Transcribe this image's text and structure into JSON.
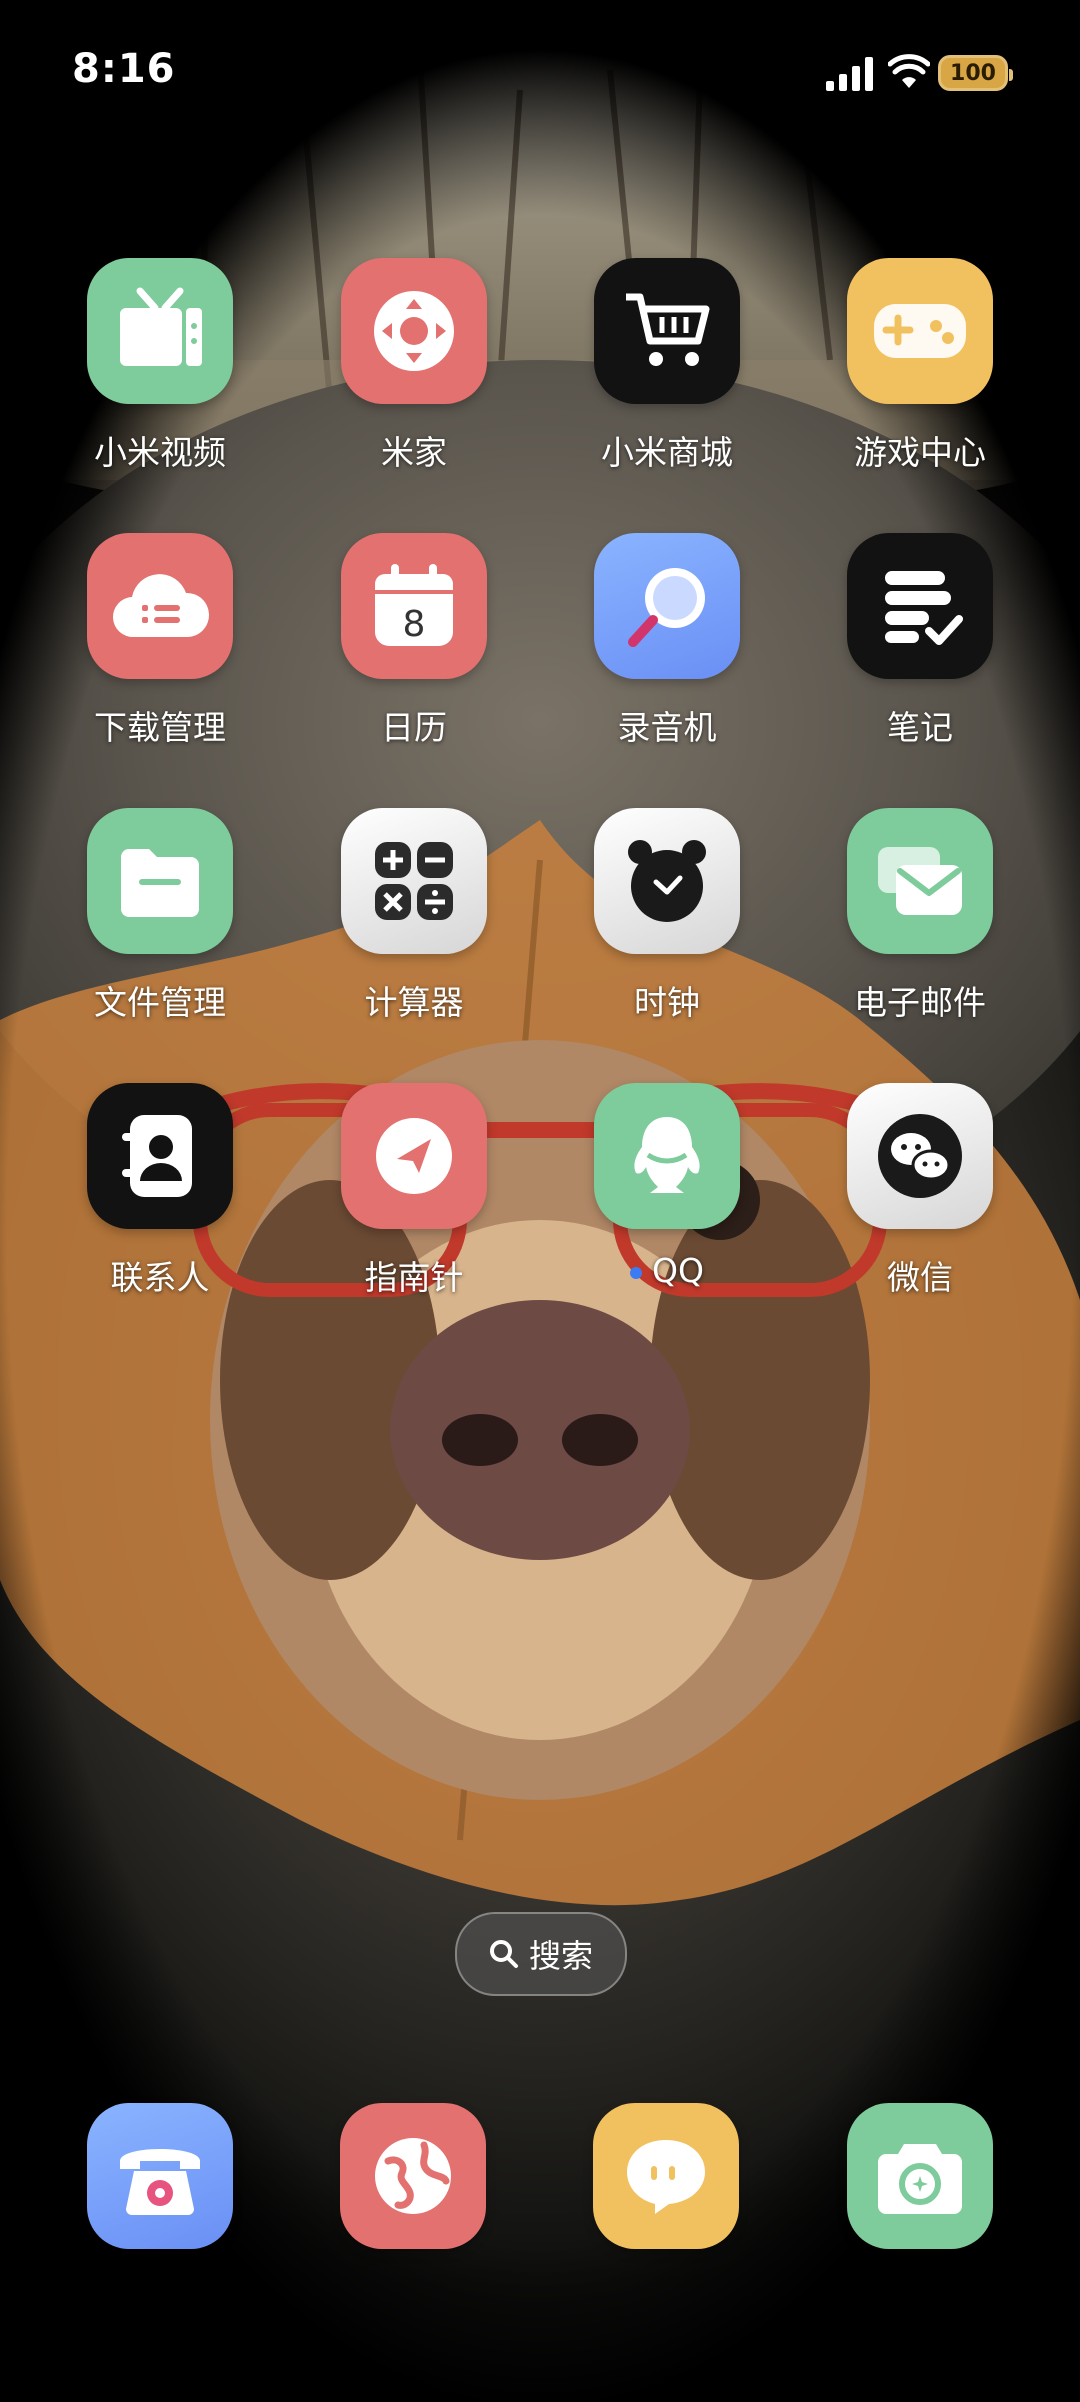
{
  "status_bar": {
    "time": "8:16",
    "battery": "100"
  },
  "apps": [
    {
      "label": "小米视频"
    },
    {
      "label": "米家"
    },
    {
      "label": "小米商城"
    },
    {
      "label": "游戏中心"
    },
    {
      "label": "下载管理"
    },
    {
      "label": "日历",
      "day": "8"
    },
    {
      "label": "录音机"
    },
    {
      "label": "笔记"
    },
    {
      "label": "文件管理"
    },
    {
      "label": "计算器"
    },
    {
      "label": "时钟"
    },
    {
      "label": "电子邮件"
    },
    {
      "label": "联系人"
    },
    {
      "label": "指南针"
    },
    {
      "label": "QQ"
    },
    {
      "label": "微信"
    }
  ],
  "search": {
    "label": "搜索"
  },
  "dock": [
    {
      "icon": "phone-icon"
    },
    {
      "icon": "browser-icon"
    },
    {
      "icon": "messages-icon"
    },
    {
      "icon": "camera-icon"
    }
  ],
  "colors": {
    "green": "#7ecb9b",
    "red": "#e2716f",
    "black": "#121212",
    "yellow": "#f2c15f",
    "blue": "#6a8ff5"
  }
}
